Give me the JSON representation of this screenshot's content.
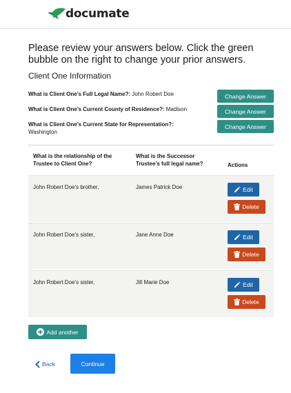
{
  "brand": {
    "name": "documate",
    "mark_color": "#2e9a58"
  },
  "intro": {
    "text": "Please review your answers below. Click the green bubble on the right to change your prior answers."
  },
  "section": {
    "title": "Client One Information"
  },
  "answers": [
    {
      "question": "What is Client One’s Full Legal Name?",
      "answer": "John Robert Doe",
      "button": "Change Answer"
    },
    {
      "question": "What is Client One’s Current County of Residence?",
      "answer": "Madison",
      "button": "Change Answer"
    },
    {
      "question": "What is Client One’s Current State for Representation?",
      "answer": "Washington",
      "button": "Change Answer"
    }
  ],
  "table": {
    "headers": [
      "What is the relationship of the Trustee to Client One?",
      "What is the Successor Trustee’s full legal name?",
      "Actions"
    ],
    "rows": [
      {
        "relationship": "John Robert Doe’s brother,",
        "name": "James Patrick Doe"
      },
      {
        "relationship": "John Robert Doe’s sister,",
        "name": "Jane Anne Doe"
      },
      {
        "relationship": "John Robert Doe’s sister,",
        "name": "Jill Marie Doe"
      }
    ],
    "edit_label": "Edit",
    "delete_label": "Delete",
    "add_label": "Add another"
  },
  "nav": {
    "back_label": "Back",
    "continue_label": "Continue"
  },
  "colors": {
    "teal": "#2e8f86",
    "edit_blue": "#1f65a8",
    "delete_orange": "#c9491c",
    "continue_blue": "#1d7fe8"
  }
}
